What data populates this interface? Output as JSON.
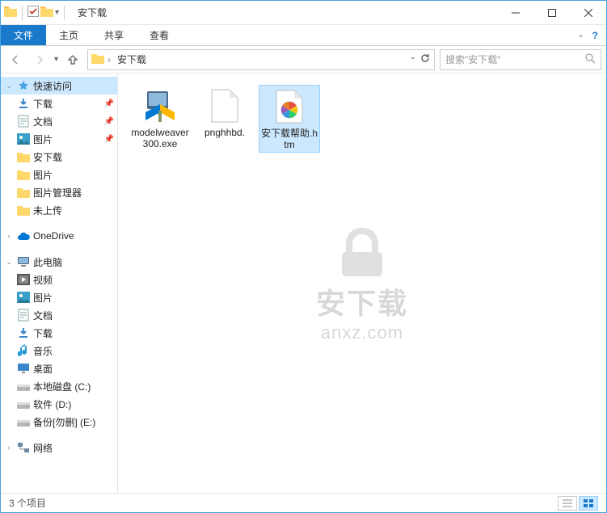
{
  "title": "安下载",
  "ribbon": {
    "file": "文件",
    "home": "主页",
    "share": "共享",
    "view": "查看"
  },
  "nav": {
    "crumb": "安下载",
    "search_placeholder": "搜索\"安下载\""
  },
  "sidebar": {
    "quick_access": "快速访问",
    "items_quick": [
      {
        "label": "下载",
        "icon": "download",
        "pinned": true
      },
      {
        "label": "文档",
        "icon": "document",
        "pinned": true
      },
      {
        "label": "图片",
        "icon": "pictures",
        "pinned": true
      },
      {
        "label": "安下载",
        "icon": "folder",
        "pinned": false
      },
      {
        "label": "图片",
        "icon": "folder",
        "pinned": false
      },
      {
        "label": "图片管理器",
        "icon": "folder",
        "pinned": false
      },
      {
        "label": "未上传",
        "icon": "folder",
        "pinned": false
      }
    ],
    "onedrive": "OneDrive",
    "this_pc": "此电脑",
    "items_pc": [
      {
        "label": "视频",
        "icon": "videos"
      },
      {
        "label": "图片",
        "icon": "pictures"
      },
      {
        "label": "文档",
        "icon": "document"
      },
      {
        "label": "下载",
        "icon": "download"
      },
      {
        "label": "音乐",
        "icon": "music"
      },
      {
        "label": "桌面",
        "icon": "desktop"
      },
      {
        "label": "本地磁盘 (C:)",
        "icon": "drive"
      },
      {
        "label": "软件 (D:)",
        "icon": "drive"
      },
      {
        "label": "备份[勿删] (E:)",
        "icon": "drive"
      }
    ],
    "network": "网络"
  },
  "files": [
    {
      "name": "modelweaver300.exe",
      "type": "exe"
    },
    {
      "name": "pnghhbd.",
      "type": "blank"
    },
    {
      "name": "安下载帮助.htm",
      "type": "htm",
      "selected": true
    }
  ],
  "status": "3 个项目",
  "watermark": {
    "text": "安下载",
    "url": "anxz.com"
  }
}
